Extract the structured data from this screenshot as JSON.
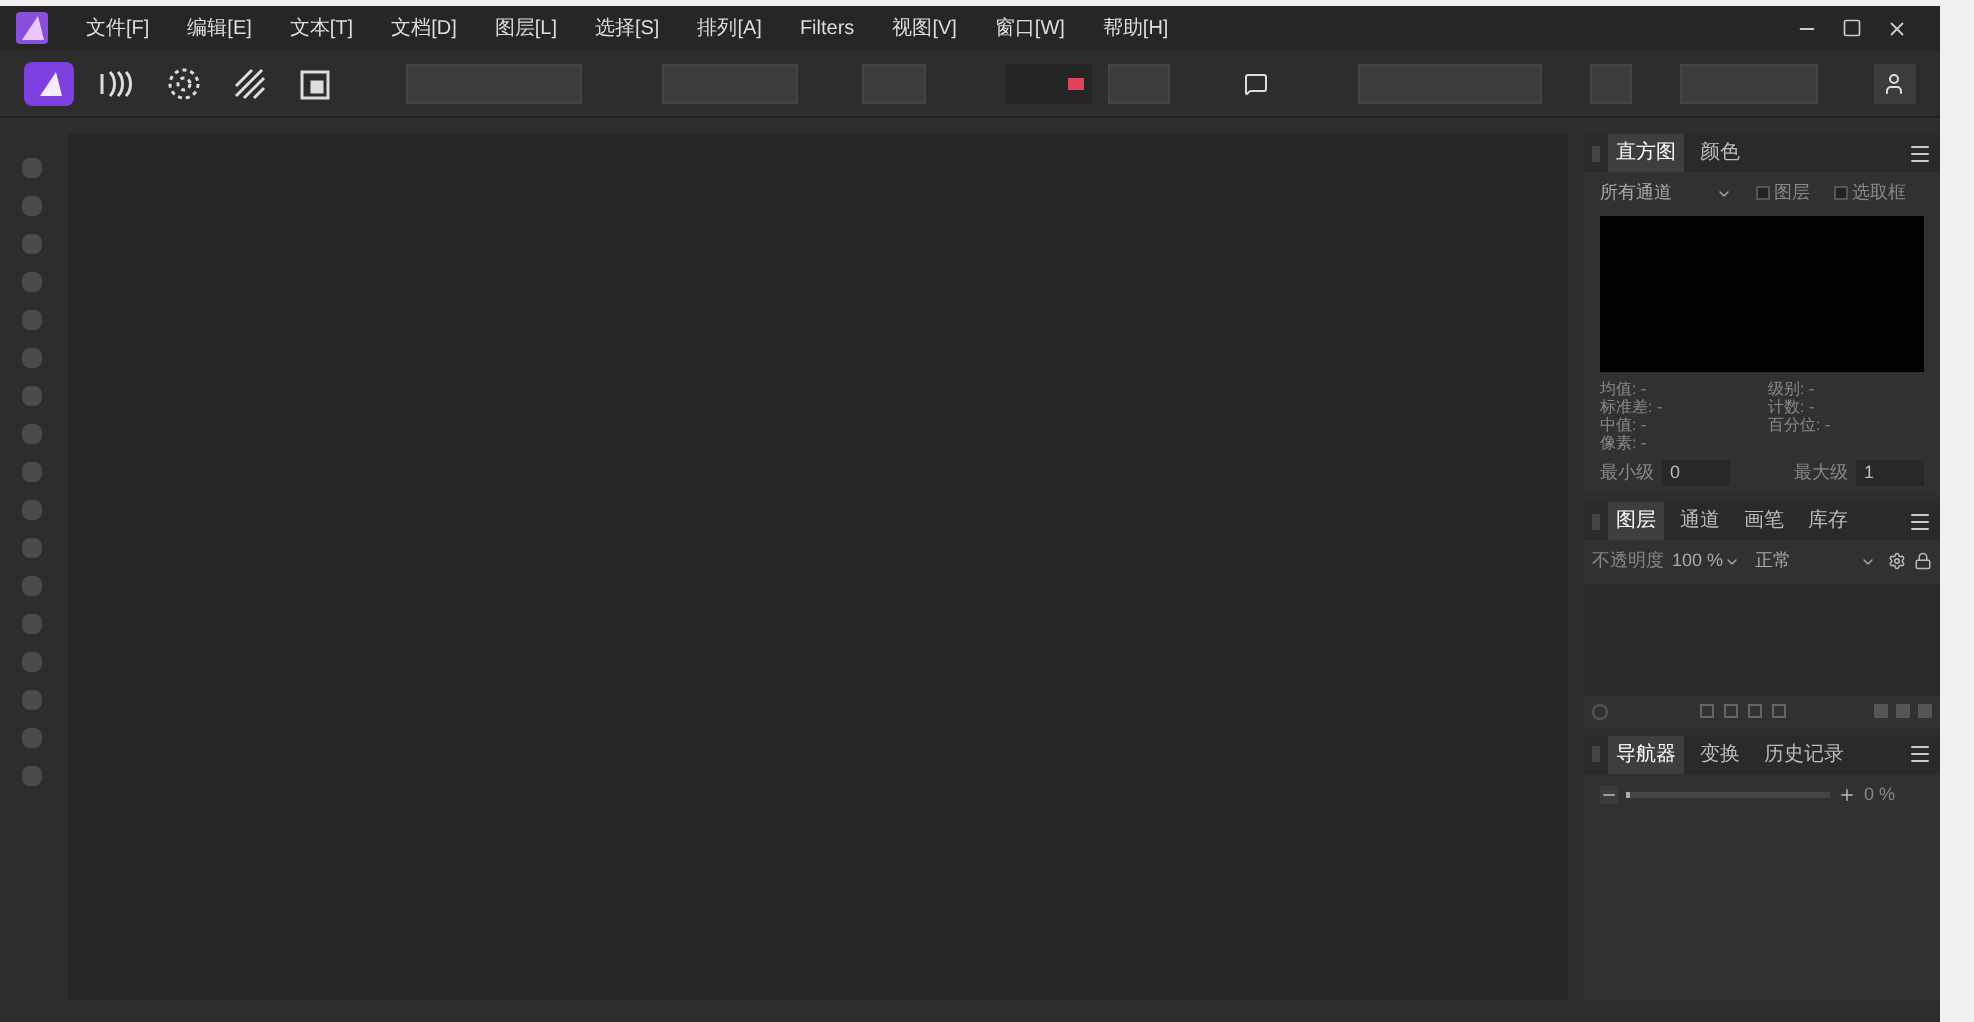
{
  "menu": [
    {
      "label": "文件[F]"
    },
    {
      "label": "编辑[E]"
    },
    {
      "label": "文本[T]"
    },
    {
      "label": "文档[D]"
    },
    {
      "label": "图层[L]"
    },
    {
      "label": "选择[S]"
    },
    {
      "label": "排列[A]"
    },
    {
      "label": "Filters"
    },
    {
      "label": "视图[V]"
    },
    {
      "label": "窗口[W]"
    },
    {
      "label": "帮助[H]"
    }
  ],
  "personas": [
    {
      "kind": "photo",
      "selected": true
    },
    {
      "kind": "liquify",
      "selected": false
    },
    {
      "kind": "develop",
      "selected": false
    },
    {
      "kind": "tonemap",
      "selected": false
    },
    {
      "kind": "export",
      "selected": false
    }
  ],
  "histogram_panel": {
    "tabs": [
      {
        "label": "直方图",
        "selected": true
      },
      {
        "label": "颜色",
        "selected": false
      }
    ],
    "channel_select": "所有通道",
    "checkboxes": [
      {
        "label": "图层",
        "checked": false
      },
      {
        "label": "选取框",
        "checked": false
      }
    ],
    "stats_left": [
      "均值: -",
      "标准差: -",
      "中值: -",
      "像素: -"
    ],
    "stats_right": [
      "级别: -",
      "计数: -",
      "百分位: -"
    ],
    "min_label": "最小级",
    "min_value": "0",
    "max_label": "最大级",
    "max_value": "1"
  },
  "layers_panel": {
    "tabs": [
      {
        "label": "图层",
        "selected": true
      },
      {
        "label": "通道",
        "selected": false
      },
      {
        "label": "画笔",
        "selected": false
      },
      {
        "label": "库存",
        "selected": false
      }
    ],
    "opacity_label": "不透明度",
    "opacity_value": "100 %",
    "blend_mode": "正常"
  },
  "navigator_panel": {
    "tabs": [
      {
        "label": "导航器",
        "selected": true
      },
      {
        "label": "变换",
        "selected": false
      },
      {
        "label": "历史记录",
        "selected": false
      }
    ],
    "zoom_value": "0 %",
    "zoom": {
      "level": 0
    }
  }
}
